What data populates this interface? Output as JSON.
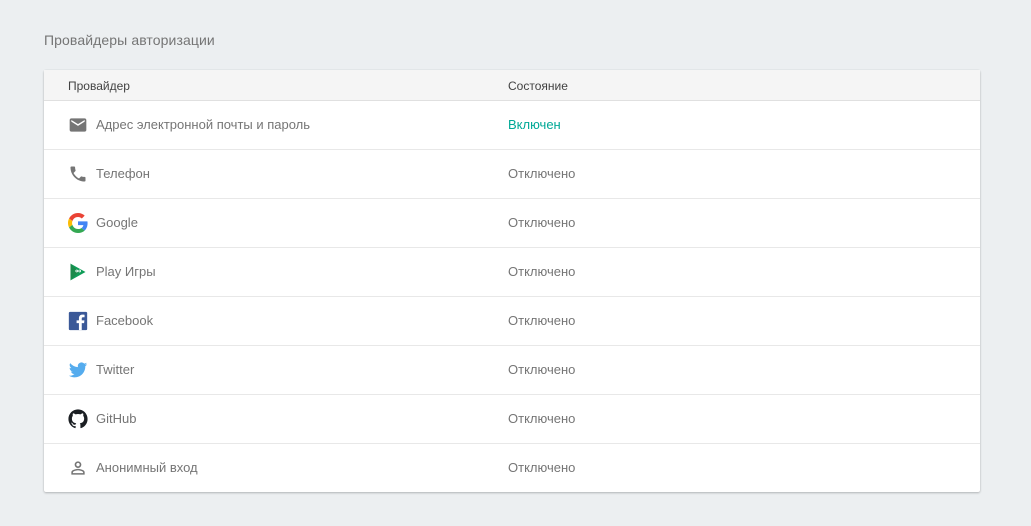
{
  "section_title": "Провайдеры авторизации",
  "table": {
    "columns": [
      "Провайдер",
      "Состояние"
    ],
    "rows": [
      {
        "icon": "email-icon",
        "name": "Адрес электронной почты и пароль",
        "status": "Включен",
        "enabled": true
      },
      {
        "icon": "phone-icon",
        "name": "Телефон",
        "status": "Отключено",
        "enabled": false
      },
      {
        "icon": "google-icon",
        "name": "Google",
        "status": "Отключено",
        "enabled": false
      },
      {
        "icon": "play-games-icon",
        "name": "Play Игры",
        "status": "Отключено",
        "enabled": false
      },
      {
        "icon": "facebook-icon",
        "name": "Facebook",
        "status": "Отключено",
        "enabled": false
      },
      {
        "icon": "twitter-icon",
        "name": "Twitter",
        "status": "Отключено",
        "enabled": false
      },
      {
        "icon": "github-icon",
        "name": "GitHub",
        "status": "Отключено",
        "enabled": false
      },
      {
        "icon": "person-icon",
        "name": "Анонимный вход",
        "status": "Отключено",
        "enabled": false
      }
    ]
  },
  "colors": {
    "enabled_status": "#00a896",
    "disabled_status": "#757575",
    "background": "#eceff1"
  }
}
